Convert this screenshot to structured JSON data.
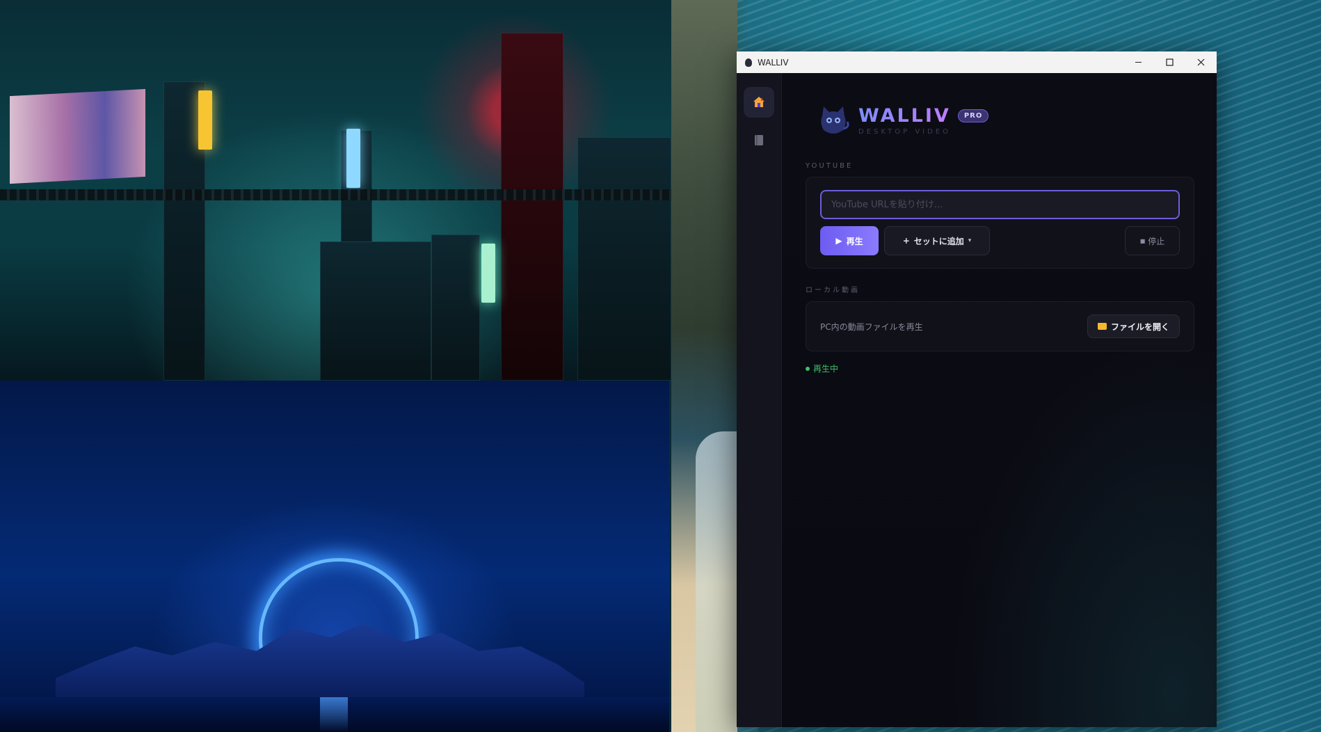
{
  "window": {
    "title": "WALLIV",
    "minimize_label": "–",
    "maximize_label": "□",
    "close_label": "✕"
  },
  "sidebar": {
    "items": [
      {
        "name": "home",
        "icon": "home-icon",
        "active": true
      },
      {
        "name": "library",
        "icon": "book-icon",
        "active": false
      }
    ]
  },
  "brand": {
    "name": "WALLIV",
    "badge": "PRO",
    "subtitle": "DESKTOP VIDEO",
    "logo_icon": "cat-icon"
  },
  "youtube": {
    "section_label": "YOUTUBE",
    "url_placeholder": "YouTube URLを貼り付け...",
    "url_value": "",
    "play_label": "再生",
    "add_to_set_label": "セットに追加",
    "stop_label": "停止"
  },
  "local": {
    "section_label": "ローカル動画",
    "description": "PC内の動画ファイルを再生",
    "open_file_label": "ファイルを開く"
  },
  "status": {
    "text": "再生中",
    "color": "#3fc06a"
  },
  "colors": {
    "accent": "#7b6cf6",
    "accent_border": "#6a5fd9",
    "window_bg": "#0b0b12"
  }
}
